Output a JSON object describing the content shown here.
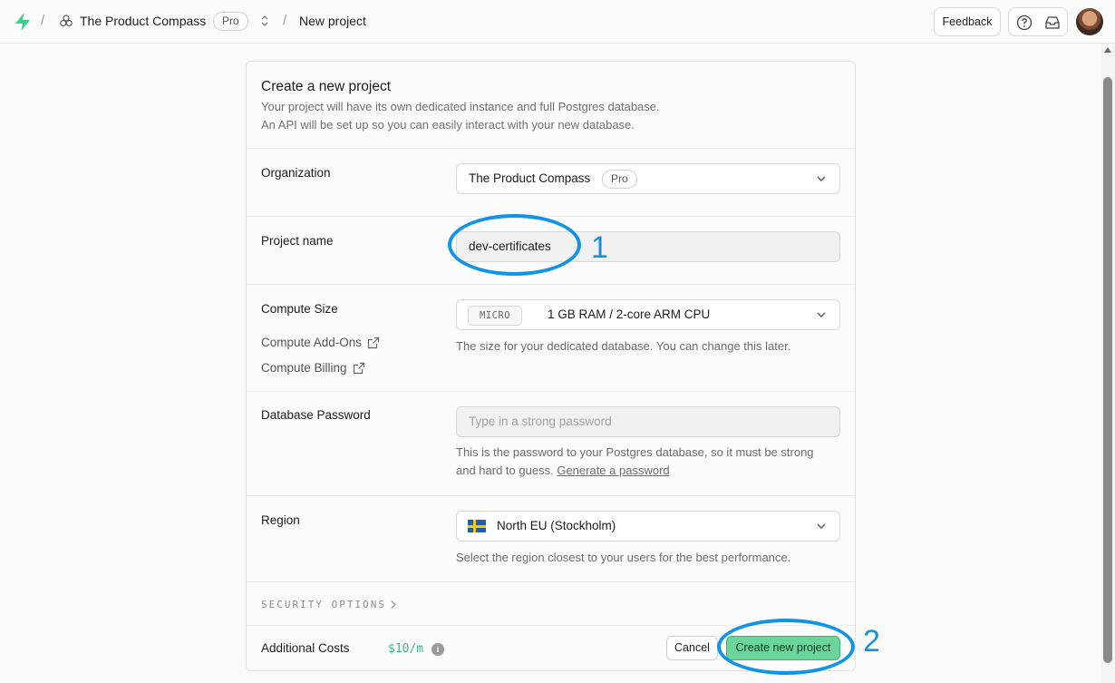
{
  "topbar": {
    "org_name": "The Product Compass",
    "plan_badge": "Pro",
    "breadcrumb_current": "New project",
    "feedback_label": "Feedback"
  },
  "form": {
    "title": "Create a new project",
    "description_line1": "Your project will have its own dedicated instance and full Postgres database.",
    "description_line2": "An API will be set up so you can easily interact with your new database.",
    "organization": {
      "label": "Organization",
      "value": "The Product Compass",
      "badge": "Pro"
    },
    "project_name": {
      "label": "Project name",
      "value": "dev-certificates"
    },
    "compute": {
      "label": "Compute Size",
      "addons_link": "Compute Add-Ons",
      "billing_link": "Compute Billing",
      "tier": "MICRO",
      "spec": "1 GB RAM / 2-core ARM CPU",
      "helper": "The size for your dedicated database. You can change this later."
    },
    "password": {
      "label": "Database Password",
      "placeholder": "Type in a strong password",
      "helper": "This is the password to your Postgres database, so it must be strong and hard to guess.",
      "generate_link": "Generate a password"
    },
    "region": {
      "label": "Region",
      "value": "North EU (Stockholm)",
      "helper": "Select the region closest to your users for the best performance."
    },
    "security_options": "SECURITY OPTIONS",
    "costs": {
      "label": "Additional Costs",
      "value": "$10/m"
    },
    "cancel_label": "Cancel",
    "create_label": "Create new project"
  },
  "annotations": {
    "marker1": "1",
    "marker2": "2",
    "color": "#1294e6"
  }
}
